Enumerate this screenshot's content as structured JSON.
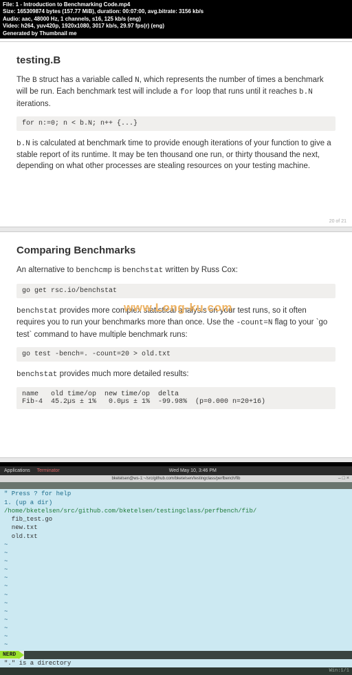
{
  "header": {
    "file": "File: 1 - Introduction to Benchmarking Code.mp4",
    "size": "Size: 165309874 bytes (157.77 MiB), duration: 00:07:00, avg.bitrate: 3156 kb/s",
    "audio": "Audio: aac, 48000 Hz, 1 channels, s16, 125 kb/s (eng)",
    "video": "Video: h264, yuv420p, 1920x1080, 3017 kb/s, 29.97 fps(r) (eng)",
    "gen": "Generated by Thumbnail me"
  },
  "slide1": {
    "title": "testing.B",
    "p1_a": "The ",
    "p1_b": " struct has a variable called ",
    "p1_c": ", which represents the number of times a benchmark will be run. Each benchmark test will include a ",
    "p1_d": " loop that runs until it reaches ",
    "p1_e": " iterations.",
    "tok_B": "B",
    "tok_N": "N",
    "tok_for": "for",
    "tok_bN": "b.N",
    "code1": "for n:=0; n < b.N; n++ {...}",
    "p2_a": " is calculated at benchmark time to provide enough iterations of your function to give a stable report of its runtime. It may be ten thousand one run, or thirty thousand the next, depending on what other processes are stealing resources on your testing machine.",
    "num": "20 of 21"
  },
  "slide2": {
    "title": "Comparing Benchmarks",
    "p1_a": "An alternative to ",
    "tok_benchcmp": "benchcmp",
    "p1_b": " is ",
    "tok_benchstat": "benchstat",
    "p1_c": " written by Russ Cox:",
    "code1": "go get rsc.io/benchstat",
    "p2_a": " provides more complex statistical analysis on your test runs, so it often requires you to run your benchmarks more than once. Use the ",
    "tok_countN": "-count=N",
    "p2_b": " flag to your `go test` command to have multiple benchmark runs:",
    "code2": "go test -bench=. -count=20 > old.txt",
    "p3_a": " provides much more detailed results:",
    "code3": "name   old time/op  new time/op  delta\nFib-4  45.2µs ± 1%   0.0µs ± 1%  -99.98%  (p=0.000 n=20+16)",
    "watermark": "www.Long-ku.com"
  },
  "term": {
    "menu_apps": "Applications",
    "menu_term": "Terminator",
    "menu_date": "Wed May 10,  3:46 PM",
    "title": "bketelsen@ws-1:~/src/github.com/bketelsen/testingclass/perfbench/fib",
    "help": "\" Press ? for help",
    "up_prefix": "1",
    "up_dir": ". (up a dir)",
    "path": "/home/bketelsen/src/github.com/bketelsen/testingclass/perfbench/fib/",
    "files": [
      "  fib_test.go",
      "  new.txt",
      "  old.txt"
    ],
    "nerd": "NERD",
    "status": "\".\" is a directory",
    "status2": "Win:1/1"
  }
}
